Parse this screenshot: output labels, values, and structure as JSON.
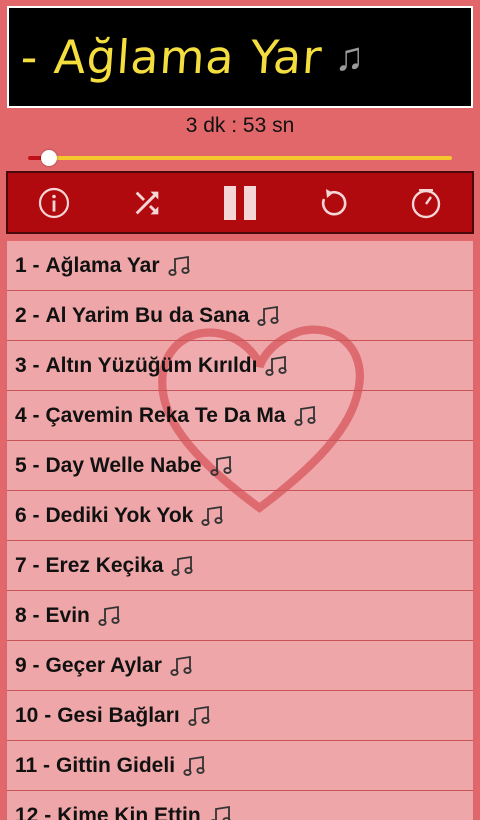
{
  "header": {
    "title": "- Ağlama Yar",
    "duration": "3 dk : 53 sn"
  },
  "player": {
    "progress": 0.05,
    "controls": [
      "info",
      "shuffle",
      "pause",
      "repeat",
      "sleep-timer"
    ]
  },
  "colors": {
    "background": "#e2676a",
    "title_text": "#f4dd3e",
    "controls_bar": "#b00a0e",
    "list_background": "#eea6a8",
    "seek_track": "#f6c72d"
  },
  "songs": [
    {
      "num": "1 -",
      "title": "Ağlama Yar"
    },
    {
      "num": "2 -",
      "title": "Al Yarim Bu da Sana"
    },
    {
      "num": "3 -",
      "title": "Altın Yüzüğüm Kırıldı"
    },
    {
      "num": "4 -",
      "title": "Çavemin Reka Te Da Ma"
    },
    {
      "num": "5 -",
      "title": "Day Welle Nabe"
    },
    {
      "num": "6 -",
      "title": "Dediki Yok Yok"
    },
    {
      "num": "7 -",
      "title": "Erez Keçika"
    },
    {
      "num": "8 -",
      "title": "Evin"
    },
    {
      "num": "9 -",
      "title": "Geçer Aylar"
    },
    {
      "num": "10 -",
      "title": "Gesi Bağları"
    },
    {
      "num": "11 -",
      "title": "Gittin Gideli"
    },
    {
      "num": "12 -",
      "title": "Kime Kin Ettin"
    }
  ]
}
